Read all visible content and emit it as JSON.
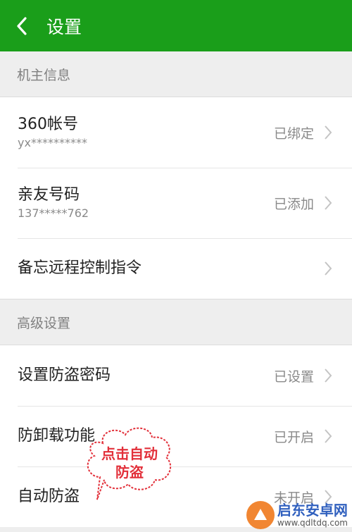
{
  "header": {
    "title": "设置"
  },
  "sections": [
    {
      "title": "机主信息"
    },
    {
      "title": "高级设置"
    }
  ],
  "owner_info": [
    {
      "label": "360帐号",
      "sub": "yx**********",
      "status": "已绑定"
    },
    {
      "label": "亲友号码",
      "sub": "137*****762",
      "status": "已添加"
    },
    {
      "label": "备忘远程控制指令"
    }
  ],
  "advanced": [
    {
      "label": "设置防盗密码",
      "status": "已设置"
    },
    {
      "label": "防卸载功能",
      "status": "已开启"
    },
    {
      "label": "自动防盗",
      "status": "未开启"
    }
  ],
  "annotation": {
    "text": "点击自动防盗",
    "color": "#e2303a"
  },
  "watermark": {
    "name": "启东安卓网",
    "url": "www.qdltdq.com"
  },
  "colors": {
    "header": "#1a9e1a",
    "background": "#eeeeee"
  }
}
